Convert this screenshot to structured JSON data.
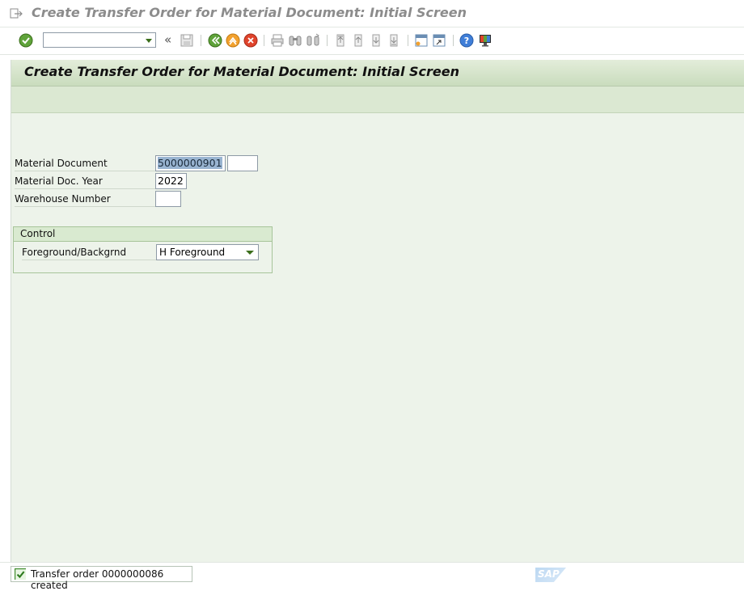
{
  "window": {
    "title": "Create Transfer Order for Material Document: Initial Screen"
  },
  "toolbar": {
    "command_field_value": "",
    "icons": [
      "enter-icon",
      "back-icon",
      "save-icon",
      "back-green-icon",
      "exit-icon",
      "cancel-icon",
      "print-icon",
      "find-icon",
      "find-next-icon",
      "first-page-icon",
      "previous-page-icon",
      "next-page-icon",
      "last-page-icon",
      "create-session-icon",
      "shortcut-icon",
      "help-icon",
      "customize-layout-icon"
    ],
    "collapse_glyph": "«"
  },
  "screen": {
    "header_title": "Create Transfer Order for Material Document: Initial Screen",
    "fields": {
      "material_document_label": "Material Document",
      "material_document_value": "5000000901",
      "material_document_item_value": "",
      "material_doc_year_label": "Material Doc. Year",
      "material_doc_year_value": "2022",
      "warehouse_number_label": "Warehouse Number",
      "warehouse_number_value": ""
    },
    "control_group": {
      "title": "Control",
      "foreground_label": "Foreground/Backgrnd",
      "foreground_value": "H Foreground"
    }
  },
  "status": {
    "message": "Transfer order 0000000086 created",
    "type": "success"
  },
  "branding": {
    "logo_text": "SAP"
  },
  "colors": {
    "accent_green": "#3b6e1b",
    "background": "#edf3ea",
    "header_band": "#c9dcbd"
  }
}
